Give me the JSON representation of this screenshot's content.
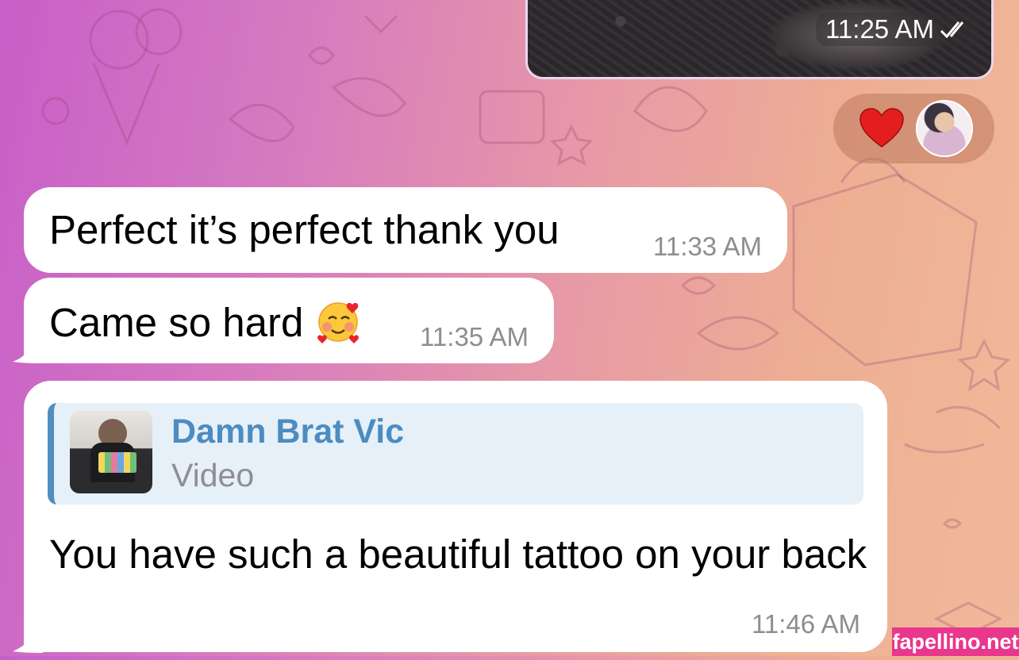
{
  "outgoing_media": {
    "time": "11:25 AM",
    "status_icon": "double-check-icon"
  },
  "reactions": {
    "emoji": "heart-icon",
    "reactor": "avatar"
  },
  "messages": [
    {
      "text": "Perfect it’s perfect thank you",
      "time": "11:33 AM"
    },
    {
      "text": "Came so hard",
      "emoji": "smiling-face-with-hearts-icon",
      "time": "11:35 AM"
    },
    {
      "reply_to": {
        "name": "Damn Brat Vic",
        "type": "Video"
      },
      "text": "You have such a beautiful tattoo on your back",
      "time": "11:46 AM"
    }
  ],
  "watermark": "fapellino.net",
  "colors": {
    "bubble": "#ffffff",
    "reply_accent": "#4e8fc1",
    "reply_bg": "#e6f0f8",
    "heart": "#e41e1e",
    "watermark_bg": "#e8378c"
  }
}
